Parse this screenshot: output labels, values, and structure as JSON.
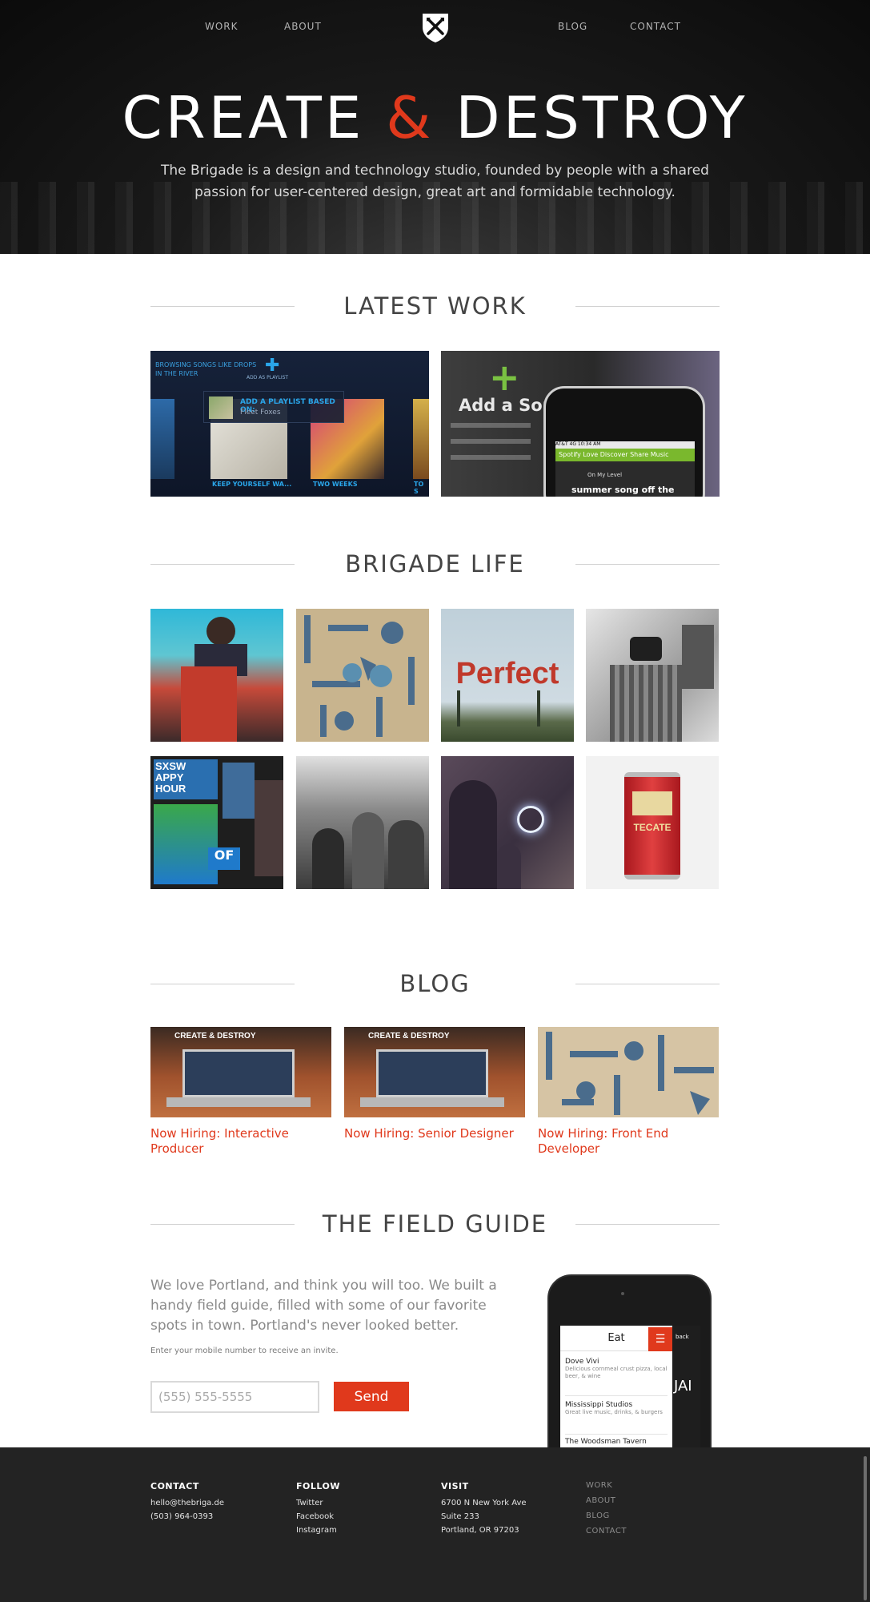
{
  "nav": {
    "work": "WORK",
    "about": "ABOUT",
    "blog": "BLOG",
    "contact": "CONTACT"
  },
  "hero": {
    "title_before": "CREATE ",
    "title_amp": "&",
    "title_after": " DESTROY",
    "subtitle": "The Brigade is a design and technology studio, founded by people with a shared passion for user-centered design, great art and formidable technology."
  },
  "sections": {
    "latest_work": "LATEST WORK",
    "brigade_life": "BRIGADE LIFE",
    "blog": "BLOG",
    "field_guide": "THE FIELD GUIDE"
  },
  "work1": {
    "browse": "BROWSING SONGS LIKE DROPS IN THE RIVER",
    "add_as_playlist": "ADD AS PLAYLIST",
    "popup_title": "ADD A PLAYLIST BASED ON:",
    "popup_artist": "Fleet Foxes",
    "cap1": "KEEP YOURSELF WA...",
    "cap2": "TWO WEEKS",
    "cap3": "TO S"
  },
  "work2": {
    "add_a_song": "Add a Son",
    "status": "AT&T  4G        10:34 AM",
    "app_tabs": "Spotify  Love Discover Share Music",
    "on_my_level": "On My Level",
    "song": "summer song off the"
  },
  "life_tiles": {
    "perfect": "Perfect",
    "sxsw": "SXSW",
    "happy_hour": "APPY HOUR",
    "tecate": "TECATE"
  },
  "blog": {
    "posts": [
      {
        "title": "Now Hiring: Interactive Producer",
        "img_text": "CREATE & DESTROY"
      },
      {
        "title": "Now Hiring: Senior Designer",
        "img_text": "CREATE & DESTROY"
      },
      {
        "title": "Now Hiring: Front End Developer",
        "img_text": ""
      }
    ]
  },
  "field_guide": {
    "text": "We love Portland, and think you will too. We built a handy field guide, filled with some of our favorite spots in town. Portland's never looked better.",
    "note": "Enter your mobile number to receive an invite.",
    "placeholder": "(555) 555-5555",
    "send": "Send",
    "phone": {
      "header": "Eat",
      "back": "back",
      "jai": "JAI",
      "items": [
        {
          "name": "Dove Vivi",
          "desc": "Delicious cornmeal crust pizza, local beer, & wine"
        },
        {
          "name": "Mississippi Studios",
          "desc": "Great live music, drinks, & burgers"
        },
        {
          "name": "The Woodsman Tavern",
          "desc": ""
        }
      ]
    }
  },
  "footer": {
    "contact": {
      "head": "CONTACT",
      "email": "hello@thebriga.de",
      "phone": "(503) 964-0393"
    },
    "follow": {
      "head": "FOLLOW",
      "twitter": "Twitter",
      "facebook": "Facebook",
      "instagram": "Instagram"
    },
    "visit": {
      "head": "VISIT",
      "line1": "6700 N New York Ave",
      "line2": "Suite 233",
      "line3": "Portland, OR 97203"
    },
    "nav": {
      "work": "WORK",
      "about": "ABOUT",
      "blog": "BLOG",
      "contact": "CONTACT"
    }
  },
  "colors": {
    "accent": "#e0391c",
    "hero_bg": "#0b0b0b",
    "footer_bg": "#232323"
  }
}
